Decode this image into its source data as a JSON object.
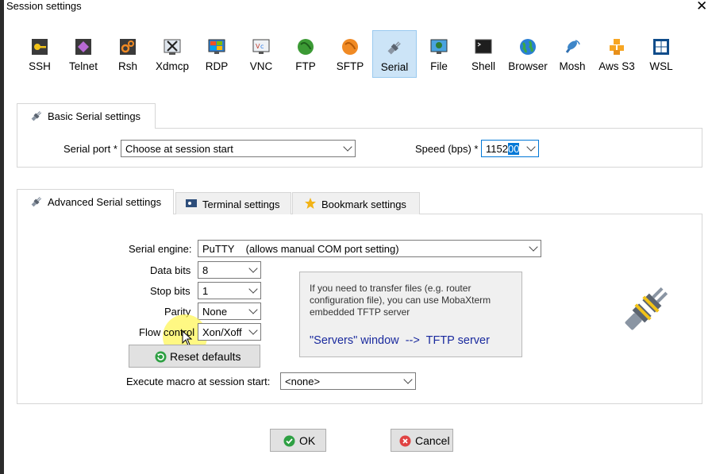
{
  "window": {
    "title": "Session settings",
    "close_glyph": "✕"
  },
  "protocols": [
    {
      "label": "SSH",
      "icon": "key-icon",
      "active": false
    },
    {
      "label": "Telnet",
      "icon": "gem-icon",
      "active": false
    },
    {
      "label": "Rsh",
      "icon": "gears-icon",
      "active": false
    },
    {
      "label": "Xdmcp",
      "icon": "x-window-icon",
      "active": false
    },
    {
      "label": "RDP",
      "icon": "monitor-icon",
      "active": false
    },
    {
      "label": "VNC",
      "icon": "vnc-icon",
      "active": false
    },
    {
      "label": "FTP",
      "icon": "green-globe-icon",
      "active": false
    },
    {
      "label": "SFTP",
      "icon": "orange-globe-icon",
      "active": false
    },
    {
      "label": "Serial",
      "icon": "serial-plug-icon",
      "active": true
    },
    {
      "label": "File",
      "icon": "file-monitor-icon",
      "active": false
    },
    {
      "label": "Shell",
      "icon": "terminal-icon",
      "active": false
    },
    {
      "label": "Browser",
      "icon": "earth-icon",
      "active": false
    },
    {
      "label": "Mosh",
      "icon": "satellite-icon",
      "active": false
    },
    {
      "label": "Aws S3",
      "icon": "cubes-icon",
      "active": false
    },
    {
      "label": "WSL",
      "icon": "windows-icon",
      "active": false
    }
  ],
  "basic": {
    "tab_label": "Basic Serial settings",
    "serial_port_label": "Serial port *",
    "serial_port_value": "Choose at session start",
    "speed_label": "Speed (bps) *",
    "speed_value_prefix": "1152",
    "speed_value_selected": "00"
  },
  "tabs": {
    "advanced": "Advanced Serial settings",
    "terminal": "Terminal settings",
    "bookmark": "Bookmark settings"
  },
  "advanced": {
    "engine_label": "Serial engine:",
    "engine_value": "PuTTY    (allows manual COM port setting)",
    "data_bits_label": "Data bits",
    "data_bits_value": "8",
    "stop_bits_label": "Stop bits",
    "stop_bits_value": "1",
    "parity_label": "Parity",
    "parity_value": "None",
    "flow_label": "Flow control",
    "flow_value": "Xon/Xoff",
    "reset_label": "Reset defaults",
    "macro_label": "Execute macro at session start:",
    "macro_value": "<none>",
    "info_text": "If you need to transfer files (e.g. router configuration file), you can use MobaXterm embedded TFTP server",
    "info_link": "\"Servers\" window  -->  TFTP server"
  },
  "buttons": {
    "ok": "OK",
    "cancel": "Cancel"
  },
  "colors": {
    "active_tab_bg": "#cce4f7",
    "selection_bg": "#0078d7",
    "info_link": "#1a2a9e",
    "ok_icon": "#2ea043",
    "cancel_icon": "#e04343"
  }
}
